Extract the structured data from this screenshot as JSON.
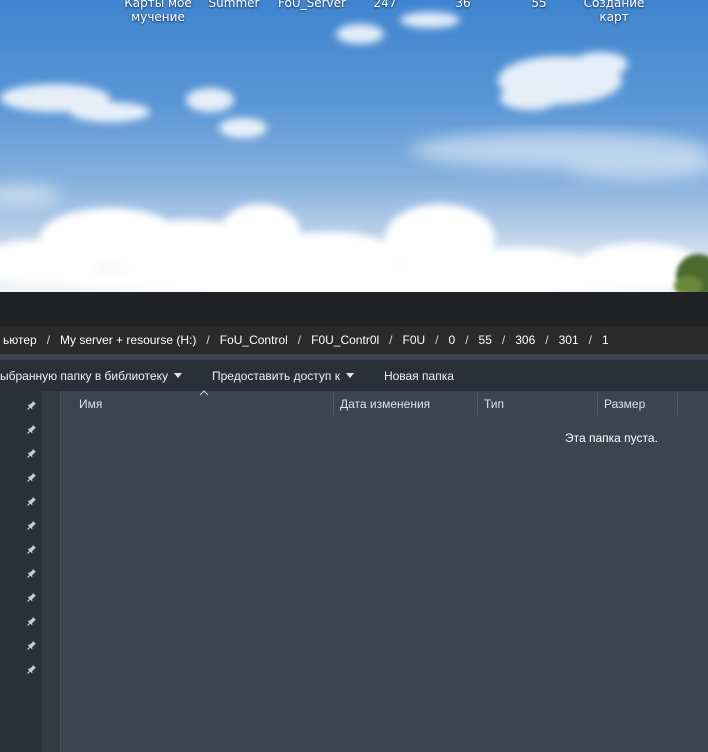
{
  "desktop": {
    "icons": [
      {
        "label": "Карты мое\nмучение"
      },
      {
        "label": "Summer"
      },
      {
        "label": "FoU_Server"
      },
      {
        "label": "247"
      },
      {
        "label": "36"
      },
      {
        "label": "55"
      },
      {
        "label": "Создание\nкарт"
      }
    ]
  },
  "address": {
    "crumbs": [
      "ьютер",
      "My server + resourse (H:)",
      "FoU_Control",
      "F0U_Contr0l",
      "F0U",
      "0",
      "55",
      "306",
      "301",
      "1"
    ],
    "separator": "/"
  },
  "toolbar": {
    "include_label": "ыбранную папку в библиотеку",
    "share_label": "Предоставить доступ к",
    "new_folder_label": "Новая папка"
  },
  "columns": {
    "name": "Имя",
    "modified": "Дата изменения",
    "type": "Тип",
    "size": "Размер"
  },
  "empty_message": "Эта папка пуста.",
  "nav_pins_count": 12,
  "colors": {
    "nav_bg": "#2b3039",
    "content_bg": "#3d4350",
    "toolbar_bg": "#2a2f3a",
    "address_bg": "#2b2b2b",
    "titlebar_bg": "#202124"
  }
}
